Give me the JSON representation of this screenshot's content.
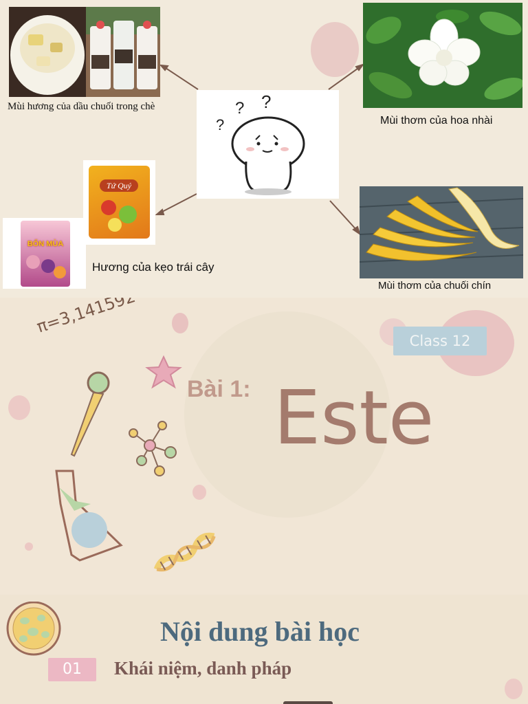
{
  "intro_slide": {
    "captions": {
      "che": "Mùi hương của dầu chuối trong chè",
      "jasmine": "Mùi thơm của hoa nhài",
      "candy": "Hương của kẹo trái cây",
      "banana": "Mùi thơm của chuối chín"
    },
    "package_labels": {
      "candy_a": "Tứ Quý",
      "candy_b": "BỐN MÙA"
    },
    "thinking_marks": [
      "?",
      "?",
      "?"
    ]
  },
  "title_slide": {
    "pi_doodle": "π=3,141592",
    "badge": "Class 12",
    "lesson_prefix": "Bài 1:",
    "lesson_title": "Este"
  },
  "contents_slide": {
    "heading": "Nội dung bài học",
    "items": [
      {
        "number": "01",
        "label": "Khái niệm, danh pháp"
      }
    ]
  },
  "colors": {
    "title_brown": "#a47b6d",
    "prefix_brown": "#c19a8c",
    "badge_blue": "#b9d0da",
    "heading_slate": "#4d6a7e",
    "item_pink": "#ecb8c4"
  }
}
